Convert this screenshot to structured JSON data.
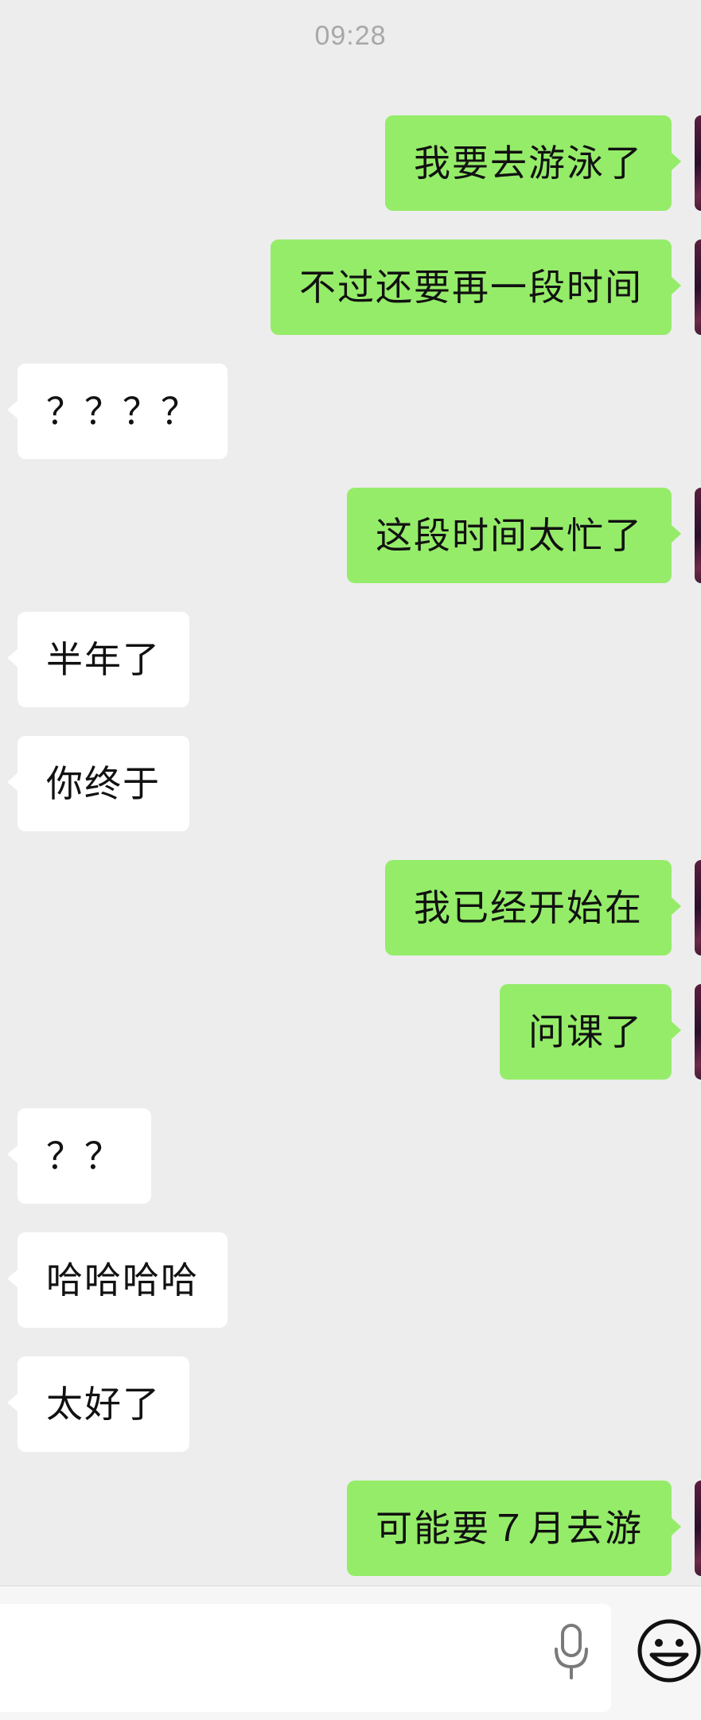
{
  "chat": {
    "timestamp": "09:28",
    "messages": [
      {
        "side": "me",
        "text": "我要去游泳了"
      },
      {
        "side": "me",
        "text": "不过还要再一段时间"
      },
      {
        "side": "other",
        "text": "？？？？"
      },
      {
        "side": "me",
        "text": "这段时间太忙了"
      },
      {
        "side": "other",
        "text": "半年了"
      },
      {
        "side": "other",
        "text": "你终于"
      },
      {
        "side": "me",
        "text": "我已经开始在"
      },
      {
        "side": "me",
        "text": "问课了"
      },
      {
        "side": "other",
        "text": "？？"
      },
      {
        "side": "other",
        "text": "哈哈哈哈"
      },
      {
        "side": "other",
        "text": "太好了"
      },
      {
        "side": "me",
        "text": "可能要７月去游"
      }
    ]
  },
  "input_bar": {
    "mic_icon": "microphone-icon",
    "emoji_icon": "smiley-emoji-icon"
  },
  "colors": {
    "background": "#ededed",
    "outgoing_bubble": "#95ec69",
    "incoming_bubble": "#ffffff",
    "timestamp_text": "#a8a8a8"
  }
}
